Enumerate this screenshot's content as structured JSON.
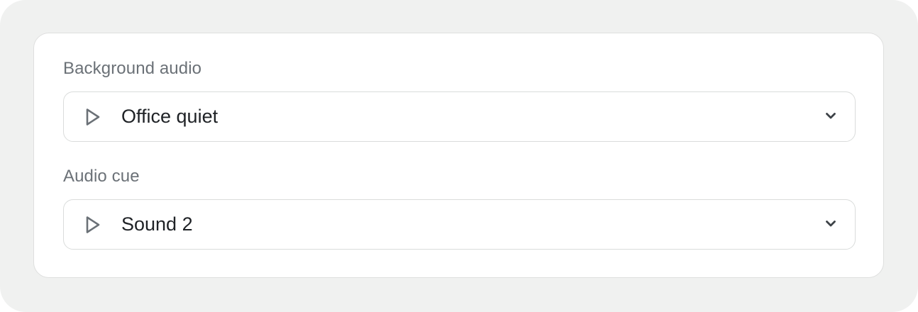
{
  "fields": [
    {
      "label": "Background audio",
      "value": "Office quiet",
      "play_icon": "play-icon",
      "dropdown_icon": "chevron-down-icon"
    },
    {
      "label": "Audio cue",
      "value": "Sound 2",
      "play_icon": "play-icon",
      "dropdown_icon": "chevron-down-icon"
    }
  ],
  "colors": {
    "page_background": "#f0f1f0",
    "card_background": "#ffffff",
    "label_text": "#6b7177",
    "value_text": "#1f2226",
    "icon": "#6b7177",
    "border": "#dadcdb"
  }
}
